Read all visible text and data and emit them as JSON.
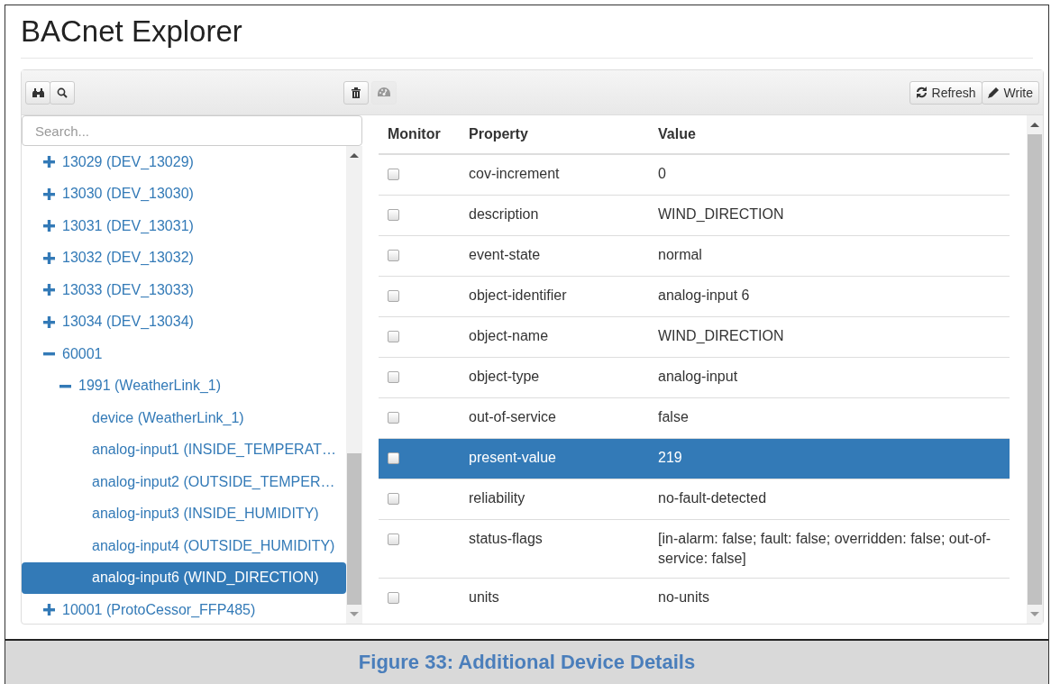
{
  "title": "BACnet Explorer",
  "toolbar": {
    "gauge_button": {
      "disabled": true
    },
    "actions": [
      {
        "label": "Refresh"
      },
      {
        "label": "Write"
      }
    ]
  },
  "search": {
    "placeholder": "Search..."
  },
  "tree": [
    {
      "label": "13029 (DEV_13029)",
      "expanded": false,
      "selected": false
    },
    {
      "label": "13030 (DEV_13030)",
      "expanded": false,
      "selected": false
    },
    {
      "label": "13031 (DEV_13031)",
      "expanded": false,
      "selected": false
    },
    {
      "label": "13032 (DEV_13032)",
      "expanded": false,
      "selected": false
    },
    {
      "label": "13033 (DEV_13033)",
      "expanded": false,
      "selected": false
    },
    {
      "label": "13034 (DEV_13034)",
      "expanded": false,
      "selected": false
    },
    {
      "label": "60001",
      "expanded": true,
      "selected": false,
      "children": [
        {
          "label": "1991 (WeatherLink_1)",
          "expanded": true,
          "selected": false,
          "children": [
            {
              "label": "device (WeatherLink_1)",
              "selected": false
            },
            {
              "label": "analog-input1 (INSIDE_TEMPERAT…",
              "selected": false
            },
            {
              "label": "analog-input2 (OUTSIDE_TEMPER…",
              "selected": false
            },
            {
              "label": "analog-input3 (INSIDE_HUMIDITY)",
              "selected": false
            },
            {
              "label": "analog-input4 (OUTSIDE_HUMIDITY)",
              "selected": false
            },
            {
              "label": "analog-input6 (WIND_DIRECTION)",
              "selected": true
            }
          ]
        }
      ]
    },
    {
      "label": "10001 (ProtoCessor_FFP485)",
      "expanded": false,
      "selected": false
    }
  ],
  "table": {
    "columns": [
      "Monitor",
      "Property",
      "Value"
    ],
    "rows": [
      {
        "property": "cov-increment",
        "value": "0",
        "checked": false,
        "selected": false
      },
      {
        "property": "description",
        "value": "WIND_DIRECTION",
        "checked": false,
        "selected": false
      },
      {
        "property": "event-state",
        "value": "normal",
        "checked": false,
        "selected": false
      },
      {
        "property": "object-identifier",
        "value": "analog-input 6",
        "checked": false,
        "selected": false
      },
      {
        "property": "object-name",
        "value": "WIND_DIRECTION",
        "checked": false,
        "selected": false
      },
      {
        "property": "object-type",
        "value": "analog-input",
        "checked": false,
        "selected": false
      },
      {
        "property": "out-of-service",
        "value": "false",
        "checked": false,
        "selected": false
      },
      {
        "property": "present-value",
        "value": "219",
        "checked": false,
        "selected": true
      },
      {
        "property": "reliability",
        "value": "no-fault-detected",
        "checked": false,
        "selected": false
      },
      {
        "property": "status-flags",
        "value": "[in-alarm: false; fault: false; overridden: false; out-of-service: false]",
        "checked": false,
        "selected": false
      },
      {
        "property": "units",
        "value": "no-units",
        "checked": false,
        "selected": false
      }
    ]
  },
  "caption": "Figure 33: Additional Device Details"
}
